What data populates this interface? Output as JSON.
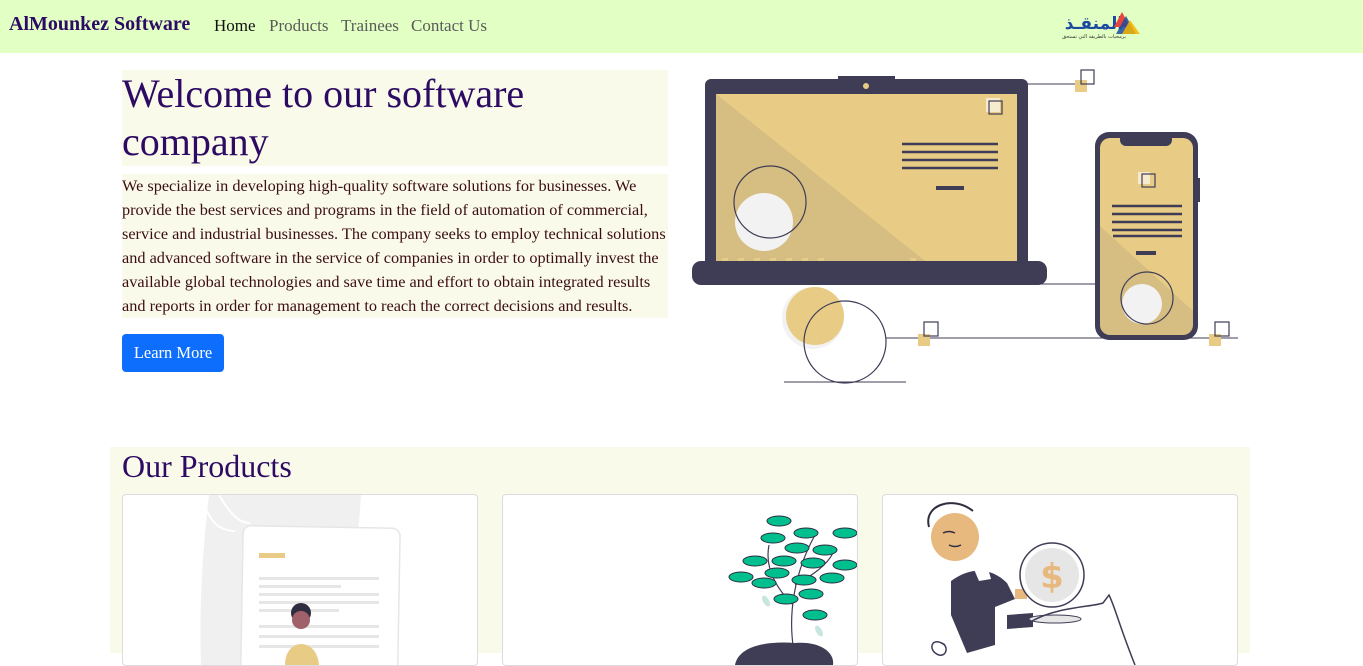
{
  "navbar": {
    "brand": "AlMounkez Software",
    "links": [
      {
        "label": "Home",
        "active": true
      },
      {
        "label": "Products",
        "active": false
      },
      {
        "label": "Trainees",
        "active": false
      },
      {
        "label": "Contact Us",
        "active": false
      }
    ],
    "logo": {
      "arabic_text": "المنقـذ",
      "tagline": "برمجيات بالطريقة التي تستحق"
    }
  },
  "hero": {
    "title": "Welcome to our software company",
    "description": "We specialize in developing high-quality software solutions for businesses. We provide the best services and programs in the field of automation of commercial, service and industrial businesses. The company seeks to employ technical solutions and advanced software in the service of companies in order to optimally invest the available global technologies and save time and effort to obtain integrated results and reports in order for management to reach the correct decisions and results.",
    "button_label": "Learn More"
  },
  "products": {
    "title": "Our Products",
    "cards": [
      {
        "illustration": "resume-document-illustration"
      },
      {
        "illustration": "money-tree-illustration"
      },
      {
        "illustration": "piggy-bank-savings-illustration"
      }
    ]
  },
  "colors": {
    "navbar_bg": "#e2ffc4",
    "heading": "#2d0a63",
    "body_text": "#3b0d12",
    "section_bg": "#f9faea",
    "primary_button": "#0d6efd",
    "illustration_gold": "#e8cc86",
    "illustration_dark": "#3f3d56",
    "leaf_green": "#00bf8e"
  }
}
